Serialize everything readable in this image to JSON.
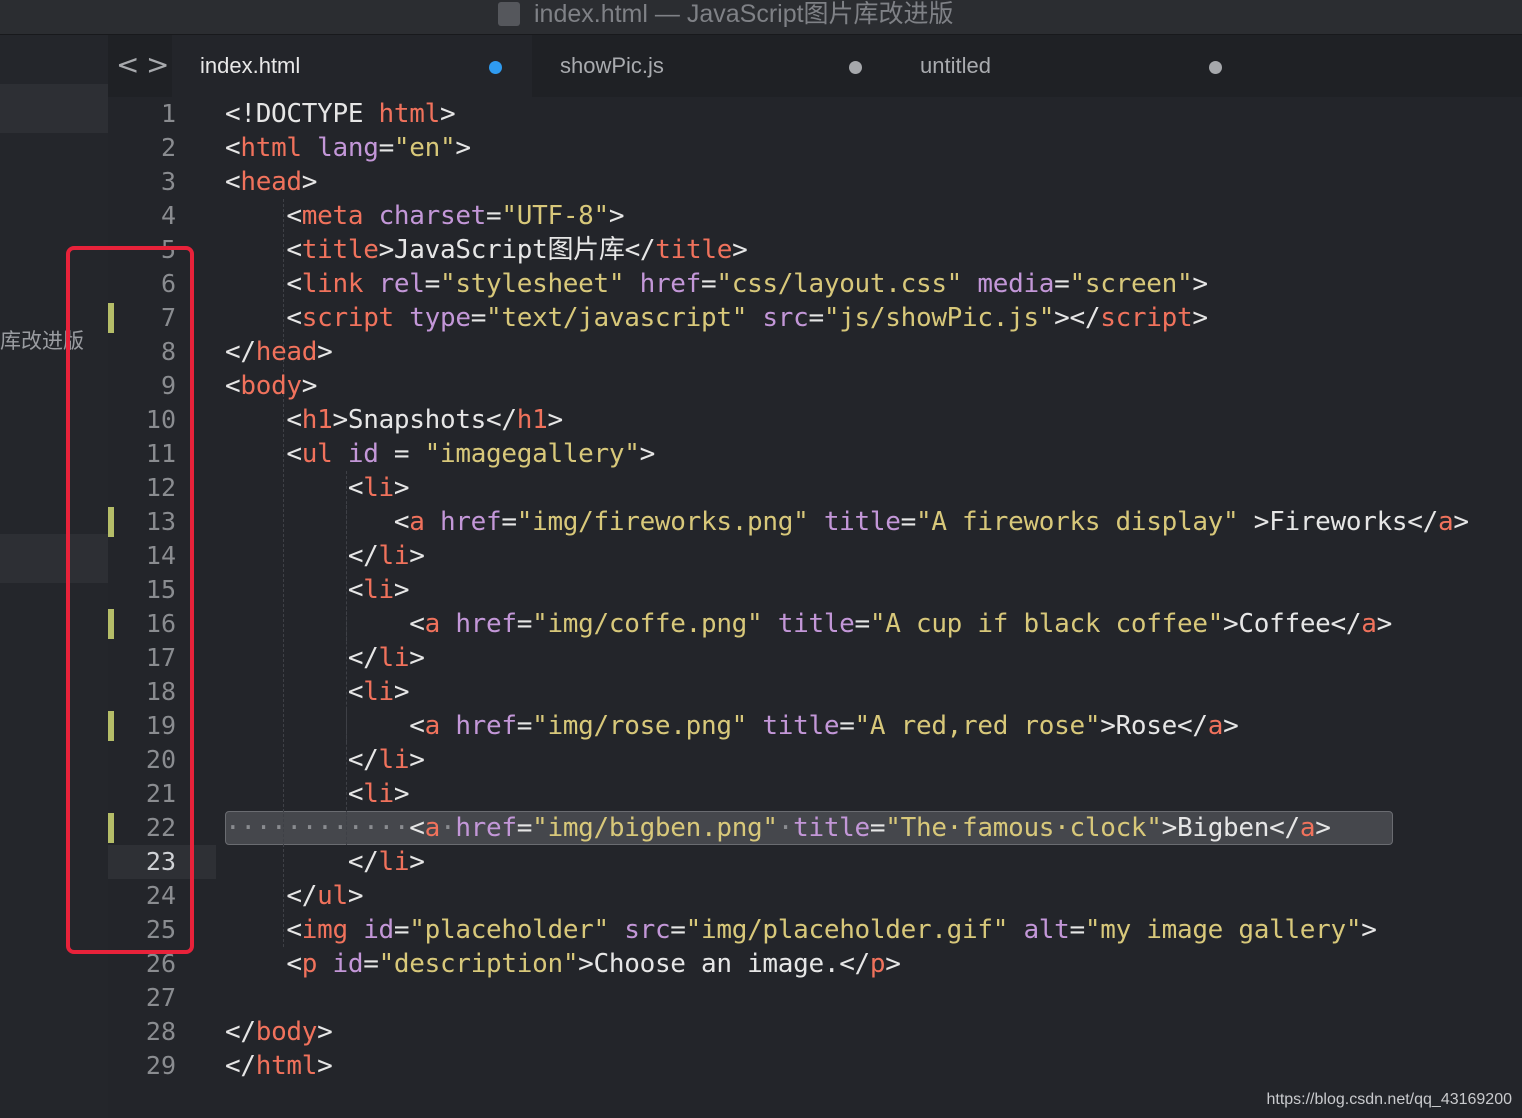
{
  "window": {
    "title": "index.html — JavaScript图片库改进版"
  },
  "sidebar": {
    "label": "库改进版"
  },
  "navigation": {
    "back": "<",
    "forward": ">"
  },
  "tabs": [
    {
      "label": "index.html",
      "dot_color": "#2f9bf0",
      "active": true
    },
    {
      "label": "showPic.js",
      "dot_color": "#a6a8ac",
      "active": false
    },
    {
      "label": "untitled",
      "dot_color": "#a6a8ac",
      "active": false
    }
  ],
  "editor": {
    "current_line": 23,
    "selected_line": 22,
    "modified_lines": [
      7,
      13,
      16,
      19,
      22
    ],
    "line_numbers": [
      "1",
      "2",
      "3",
      "4",
      "5",
      "6",
      "7",
      "8",
      "9",
      "10",
      "11",
      "12",
      "13",
      "14",
      "15",
      "16",
      "17",
      "18",
      "19",
      "20",
      "21",
      "22",
      "23",
      "24",
      "25",
      "26",
      "27",
      "28",
      "29"
    ],
    "lines": [
      [
        {
          "c": "p",
          "t": "<!DOCTYPE "
        },
        {
          "c": "t",
          "t": "html"
        },
        {
          "c": "p",
          "t": ">"
        }
      ],
      [
        {
          "c": "p",
          "t": "<"
        },
        {
          "c": "t",
          "t": "html"
        },
        {
          "c": "p",
          "t": " "
        },
        {
          "c": "a",
          "t": "lang"
        },
        {
          "c": "p",
          "t": "="
        },
        {
          "c": "s",
          "t": "\"en\""
        },
        {
          "c": "p",
          "t": ">"
        }
      ],
      [
        {
          "c": "p",
          "t": "<"
        },
        {
          "c": "t",
          "t": "head"
        },
        {
          "c": "p",
          "t": ">"
        }
      ],
      [
        {
          "c": "p",
          "t": "    <"
        },
        {
          "c": "t",
          "t": "meta"
        },
        {
          "c": "p",
          "t": " "
        },
        {
          "c": "a",
          "t": "charset"
        },
        {
          "c": "p",
          "t": "="
        },
        {
          "c": "s",
          "t": "\"UTF-8\""
        },
        {
          "c": "p",
          "t": ">"
        }
      ],
      [
        {
          "c": "p",
          "t": "    <"
        },
        {
          "c": "t",
          "t": "title"
        },
        {
          "c": "p",
          "t": ">"
        },
        {
          "c": "x",
          "t": "JavaScript图片库"
        },
        {
          "c": "p",
          "t": "</"
        },
        {
          "c": "t",
          "t": "title"
        },
        {
          "c": "p",
          "t": ">"
        }
      ],
      [
        {
          "c": "p",
          "t": "    <"
        },
        {
          "c": "t",
          "t": "link"
        },
        {
          "c": "p",
          "t": " "
        },
        {
          "c": "a",
          "t": "rel"
        },
        {
          "c": "p",
          "t": "="
        },
        {
          "c": "s",
          "t": "\"stylesheet\""
        },
        {
          "c": "p",
          "t": " "
        },
        {
          "c": "a",
          "t": "href"
        },
        {
          "c": "p",
          "t": "="
        },
        {
          "c": "s",
          "t": "\"css/layout.css\""
        },
        {
          "c": "p",
          "t": " "
        },
        {
          "c": "a",
          "t": "media"
        },
        {
          "c": "p",
          "t": "="
        },
        {
          "c": "s",
          "t": "\"screen\""
        },
        {
          "c": "p",
          "t": ">"
        }
      ],
      [
        {
          "c": "p",
          "t": "    <"
        },
        {
          "c": "t",
          "t": "script"
        },
        {
          "c": "p",
          "t": " "
        },
        {
          "c": "a",
          "t": "type"
        },
        {
          "c": "p",
          "t": "="
        },
        {
          "c": "s",
          "t": "\"text/javascript\""
        },
        {
          "c": "p",
          "t": " "
        },
        {
          "c": "a",
          "t": "src"
        },
        {
          "c": "p",
          "t": "="
        },
        {
          "c": "s",
          "t": "\"js/showPic.js\""
        },
        {
          "c": "p",
          "t": "></"
        },
        {
          "c": "t",
          "t": "script"
        },
        {
          "c": "p",
          "t": ">"
        }
      ],
      [
        {
          "c": "p",
          "t": "</"
        },
        {
          "c": "t",
          "t": "head"
        },
        {
          "c": "p",
          "t": ">"
        }
      ],
      [
        {
          "c": "p",
          "t": "<"
        },
        {
          "c": "t",
          "t": "body"
        },
        {
          "c": "p",
          "t": ">"
        }
      ],
      [
        {
          "c": "p",
          "t": "    <"
        },
        {
          "c": "t",
          "t": "h1"
        },
        {
          "c": "p",
          "t": ">"
        },
        {
          "c": "x",
          "t": "Snapshots"
        },
        {
          "c": "p",
          "t": "</"
        },
        {
          "c": "t",
          "t": "h1"
        },
        {
          "c": "p",
          "t": ">"
        }
      ],
      [
        {
          "c": "p",
          "t": "    <"
        },
        {
          "c": "t",
          "t": "ul"
        },
        {
          "c": "p",
          "t": " "
        },
        {
          "c": "a",
          "t": "id"
        },
        {
          "c": "p",
          "t": " = "
        },
        {
          "c": "s",
          "t": "\"imagegallery\""
        },
        {
          "c": "p",
          "t": ">"
        }
      ],
      [
        {
          "c": "p",
          "t": "        <"
        },
        {
          "c": "t",
          "t": "li"
        },
        {
          "c": "p",
          "t": ">"
        }
      ],
      [
        {
          "c": "p",
          "t": "           <"
        },
        {
          "c": "t",
          "t": "a"
        },
        {
          "c": "p",
          "t": " "
        },
        {
          "c": "a",
          "t": "href"
        },
        {
          "c": "p",
          "t": "="
        },
        {
          "c": "s",
          "t": "\"img/fireworks.png\""
        },
        {
          "c": "p",
          "t": " "
        },
        {
          "c": "a",
          "t": "title"
        },
        {
          "c": "p",
          "t": "="
        },
        {
          "c": "s",
          "t": "\"A fireworks display\""
        },
        {
          "c": "p",
          "t": " >"
        },
        {
          "c": "x",
          "t": "Fireworks"
        },
        {
          "c": "p",
          "t": "</"
        },
        {
          "c": "t",
          "t": "a"
        },
        {
          "c": "p",
          "t": ">"
        }
      ],
      [
        {
          "c": "p",
          "t": "        </"
        },
        {
          "c": "t",
          "t": "li"
        },
        {
          "c": "p",
          "t": ">"
        }
      ],
      [
        {
          "c": "p",
          "t": "        <"
        },
        {
          "c": "t",
          "t": "li"
        },
        {
          "c": "p",
          "t": ">"
        }
      ],
      [
        {
          "c": "p",
          "t": "            <"
        },
        {
          "c": "t",
          "t": "a"
        },
        {
          "c": "p",
          "t": " "
        },
        {
          "c": "a",
          "t": "href"
        },
        {
          "c": "p",
          "t": "="
        },
        {
          "c": "s",
          "t": "\"img/coffe.png\""
        },
        {
          "c": "p",
          "t": " "
        },
        {
          "c": "a",
          "t": "title"
        },
        {
          "c": "p",
          "t": "="
        },
        {
          "c": "s",
          "t": "\"A cup if black coffee\""
        },
        {
          "c": "p",
          "t": ">"
        },
        {
          "c": "x",
          "t": "Coffee"
        },
        {
          "c": "p",
          "t": "</"
        },
        {
          "c": "t",
          "t": "a"
        },
        {
          "c": "p",
          "t": ">"
        }
      ],
      [
        {
          "c": "p",
          "t": "        </"
        },
        {
          "c": "t",
          "t": "li"
        },
        {
          "c": "p",
          "t": ">"
        }
      ],
      [
        {
          "c": "p",
          "t": "        <"
        },
        {
          "c": "t",
          "t": "li"
        },
        {
          "c": "p",
          "t": ">"
        }
      ],
      [
        {
          "c": "p",
          "t": "            <"
        },
        {
          "c": "t",
          "t": "a"
        },
        {
          "c": "p",
          "t": " "
        },
        {
          "c": "a",
          "t": "href"
        },
        {
          "c": "p",
          "t": "="
        },
        {
          "c": "s",
          "t": "\"img/rose.png\""
        },
        {
          "c": "p",
          "t": " "
        },
        {
          "c": "a",
          "t": "title"
        },
        {
          "c": "p",
          "t": "="
        },
        {
          "c": "s",
          "t": "\"A red,red rose\""
        },
        {
          "c": "p",
          "t": ">"
        },
        {
          "c": "x",
          "t": "Rose"
        },
        {
          "c": "p",
          "t": "</"
        },
        {
          "c": "t",
          "t": "a"
        },
        {
          "c": "p",
          "t": ">"
        }
      ],
      [
        {
          "c": "p",
          "t": "        </"
        },
        {
          "c": "t",
          "t": "li"
        },
        {
          "c": "p",
          "t": ">"
        }
      ],
      [
        {
          "c": "p",
          "t": "        <"
        },
        {
          "c": "t",
          "t": "li"
        },
        {
          "c": "p",
          "t": ">"
        }
      ],
      [
        {
          "c": "w",
          "t": "············"
        },
        {
          "c": "p",
          "t": "<"
        },
        {
          "c": "t",
          "t": "a"
        },
        {
          "c": "w",
          "t": "·"
        },
        {
          "c": "a",
          "t": "href"
        },
        {
          "c": "p",
          "t": "="
        },
        {
          "c": "s",
          "t": "\"img/bigben.png\""
        },
        {
          "c": "w",
          "t": "·"
        },
        {
          "c": "a",
          "t": "title"
        },
        {
          "c": "p",
          "t": "="
        },
        {
          "c": "s",
          "t": "\"The·famous·clock\""
        },
        {
          "c": "p",
          "t": ">"
        },
        {
          "c": "x",
          "t": "Bigben"
        },
        {
          "c": "p",
          "t": "</"
        },
        {
          "c": "t",
          "t": "a"
        },
        {
          "c": "p",
          "t": ">"
        }
      ],
      [
        {
          "c": "p",
          "t": "        </"
        },
        {
          "c": "t",
          "t": "li"
        },
        {
          "c": "p",
          "t": ">"
        }
      ],
      [
        {
          "c": "p",
          "t": "    </"
        },
        {
          "c": "t",
          "t": "ul"
        },
        {
          "c": "p",
          "t": ">"
        }
      ],
      [
        {
          "c": "p",
          "t": "    <"
        },
        {
          "c": "t",
          "t": "img"
        },
        {
          "c": "p",
          "t": " "
        },
        {
          "c": "a",
          "t": "id"
        },
        {
          "c": "p",
          "t": "="
        },
        {
          "c": "s",
          "t": "\"placeholder\""
        },
        {
          "c": "p",
          "t": " "
        },
        {
          "c": "a",
          "t": "src"
        },
        {
          "c": "p",
          "t": "="
        },
        {
          "c": "s",
          "t": "\"img/placeholder.gif\""
        },
        {
          "c": "p",
          "t": " "
        },
        {
          "c": "a",
          "t": "alt"
        },
        {
          "c": "p",
          "t": "="
        },
        {
          "c": "s",
          "t": "\"my image gallery\""
        },
        {
          "c": "p",
          "t": ">"
        }
      ],
      [
        {
          "c": "p",
          "t": "    <"
        },
        {
          "c": "t",
          "t": "p"
        },
        {
          "c": "p",
          "t": " "
        },
        {
          "c": "a",
          "t": "id"
        },
        {
          "c": "p",
          "t": "="
        },
        {
          "c": "s",
          "t": "\"description\""
        },
        {
          "c": "p",
          "t": ">"
        },
        {
          "c": "x",
          "t": "Choose an image."
        },
        {
          "c": "p",
          "t": "</"
        },
        {
          "c": "t",
          "t": "p"
        },
        {
          "c": "p",
          "t": ">"
        }
      ],
      [],
      [
        {
          "c": "p",
          "t": "</"
        },
        {
          "c": "t",
          "t": "body"
        },
        {
          "c": "p",
          "t": ">"
        }
      ],
      [
        {
          "c": "p",
          "t": "</"
        },
        {
          "c": "t",
          "t": "html"
        },
        {
          "c": "p",
          "t": ">"
        }
      ]
    ]
  },
  "colors": {
    "tag": "#f0725c",
    "attribute": "#c397d8",
    "string": "#d8c87a",
    "text": "#e6e6e6",
    "annotation_box": "#e8223a",
    "modified_marker": "#b5bd68"
  },
  "watermark": "https://blog.csdn.net/qq_43169200"
}
